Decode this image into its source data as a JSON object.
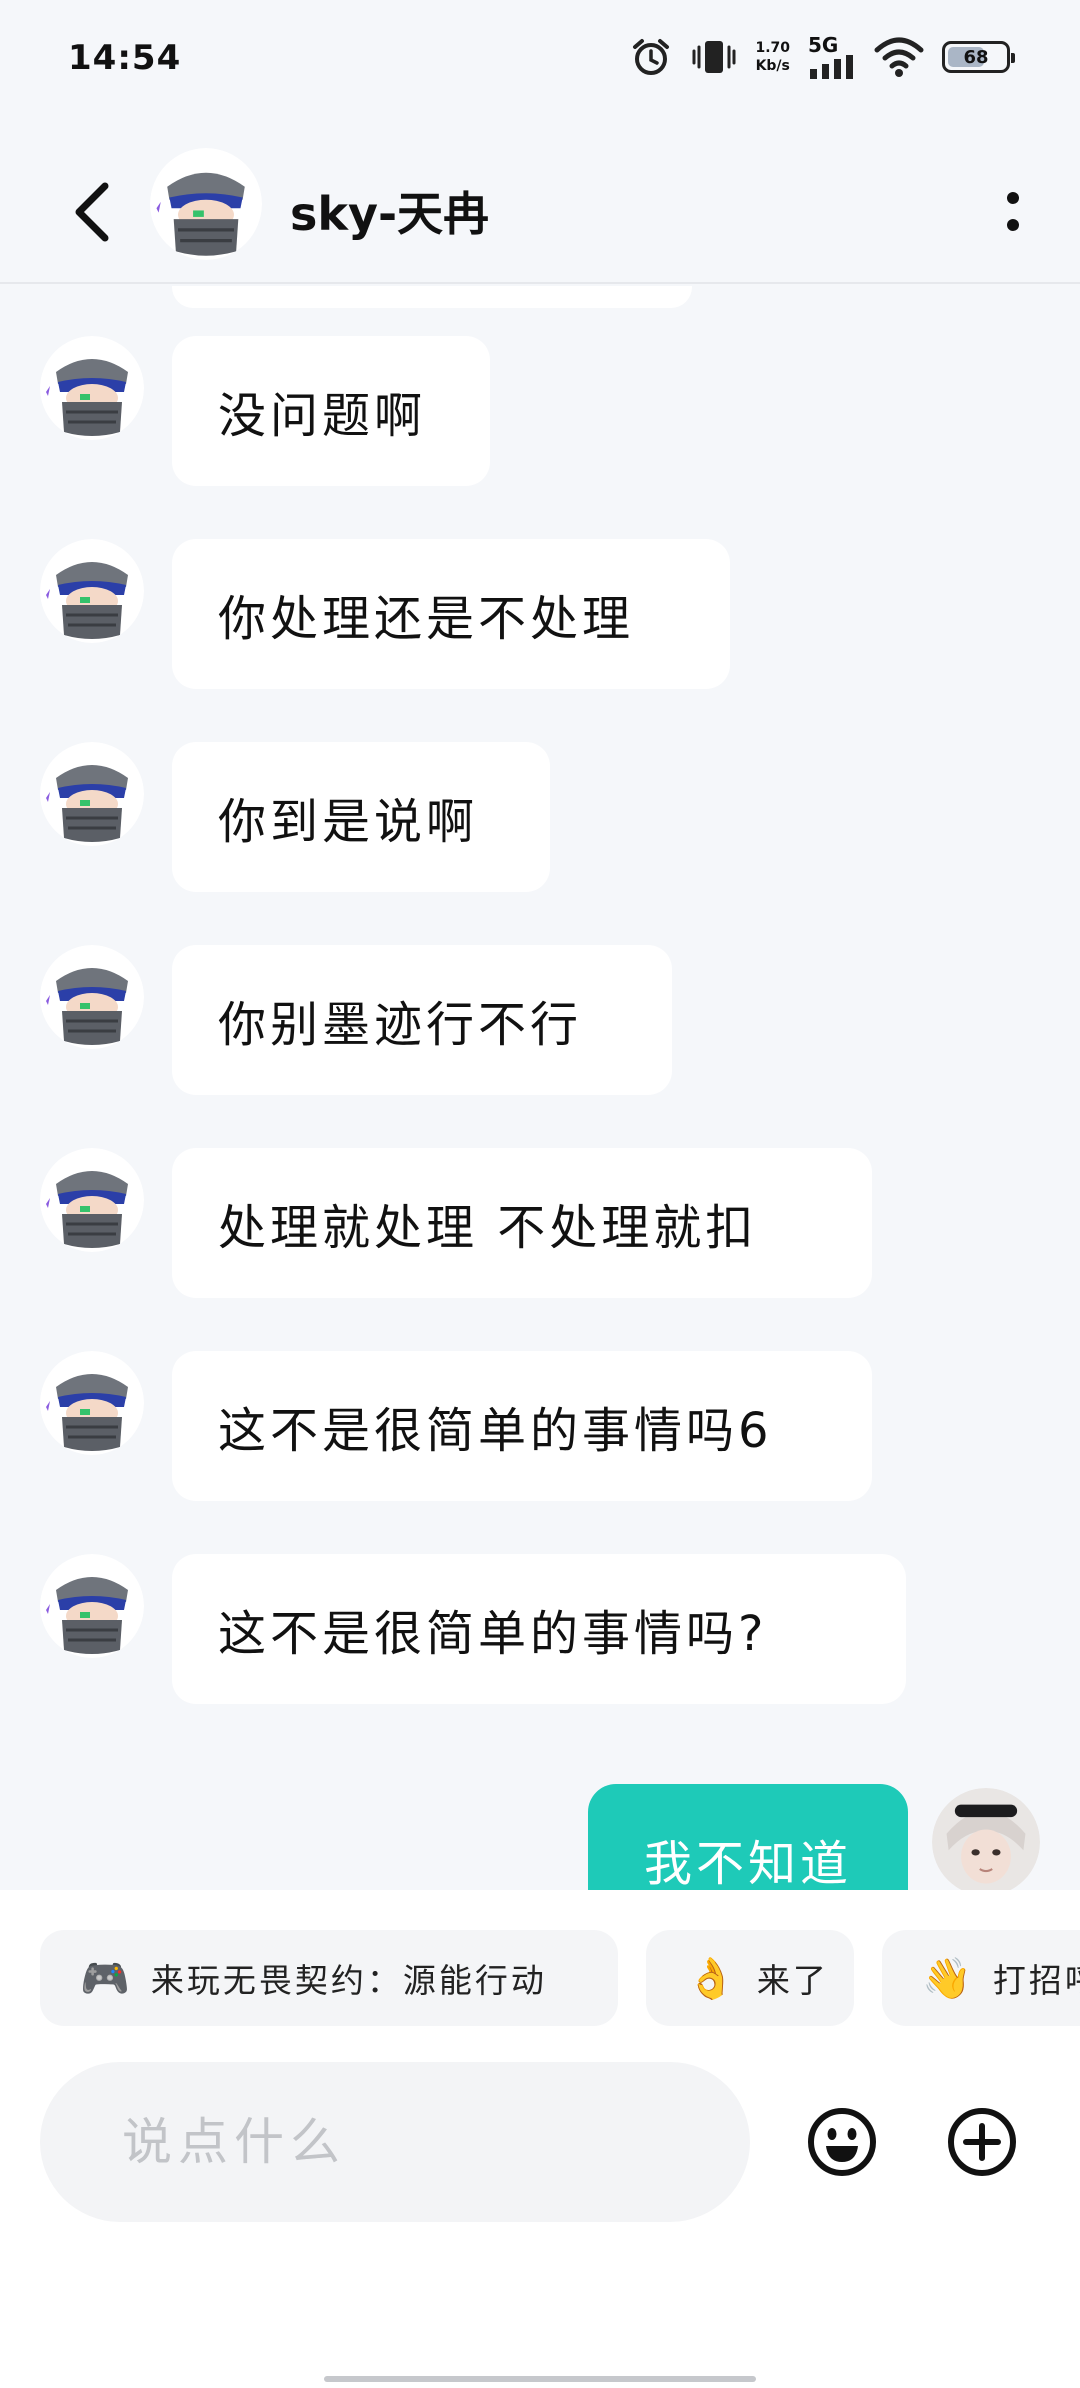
{
  "status_bar": {
    "time": "14:54",
    "net_speed_value": "1.70",
    "net_speed_unit": "Kb/s",
    "network": "5G",
    "battery": "68",
    "battery_level_percent": 68,
    "icons": [
      "alarm-icon",
      "vibrate-icon",
      "signal-icon",
      "wifi-icon",
      "battery-icon"
    ]
  },
  "header": {
    "contact_name": "sky-天冉",
    "icons": [
      "back-arrow-icon",
      "more-vertical-icon"
    ]
  },
  "messages": [
    {
      "from": "contact",
      "text": "没问题啊"
    },
    {
      "from": "contact",
      "text": "你处理还是不处理"
    },
    {
      "from": "contact",
      "text": "你到是说啊"
    },
    {
      "from": "contact",
      "text": "你别墨迹行不行"
    },
    {
      "from": "contact",
      "text": "处理就处理 不处理就扣"
    },
    {
      "from": "contact",
      "text": "这不是很简单的事情吗6"
    },
    {
      "from": "contact",
      "text": "这不是很简单的事情吗?"
    },
    {
      "from": "me",
      "text": "我不知道"
    }
  ],
  "quick_replies": [
    {
      "emoji": "🎮",
      "label": "来玩无畏契约：源能行动"
    },
    {
      "emoji": "👌",
      "label": "来了"
    },
    {
      "emoji": "👋",
      "label": "打招呼"
    }
  ],
  "composer": {
    "placeholder": "说点什么",
    "icons": [
      "emoji-icon",
      "plus-icon"
    ]
  },
  "colors": {
    "background": "#f5f7fa",
    "outgoing_bubble": "#1ecab8",
    "incoming_bubble": "#ffffff"
  }
}
